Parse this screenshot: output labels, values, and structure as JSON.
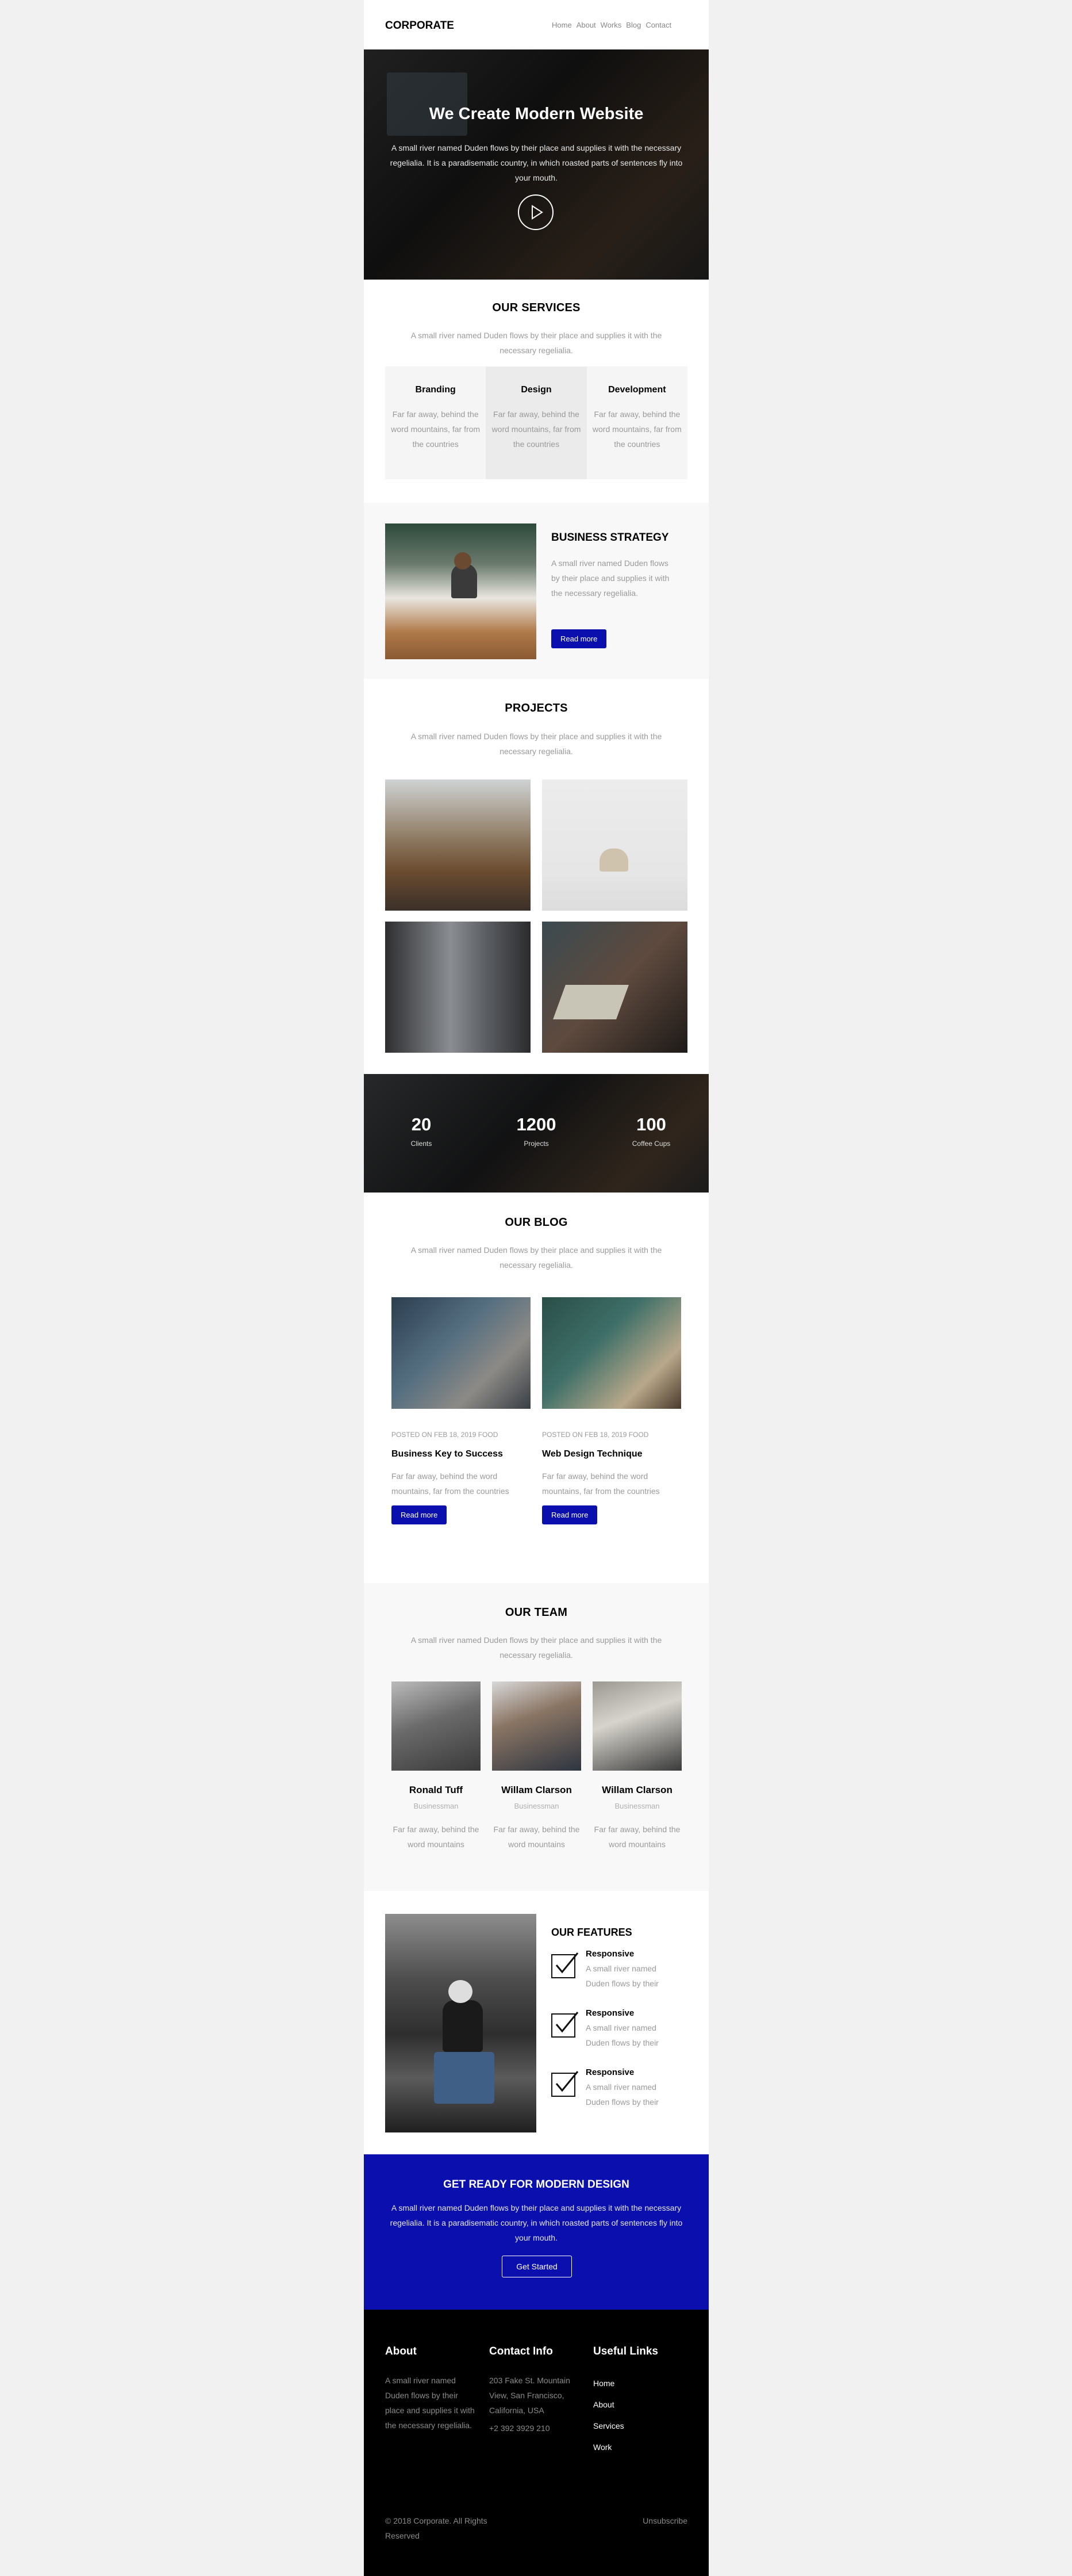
{
  "brand": "CORPORATE",
  "nav": [
    "Home",
    "About",
    "Works",
    "Blog",
    "Contact"
  ],
  "hero": {
    "title": "We Create Modern Website",
    "text": "A small river named Duden flows by their place and supplies it with the necessary regelialia. It is a paradisematic country, in which roasted parts of sentences fly into your mouth."
  },
  "services": {
    "title": "OUR SERVICES",
    "subtitle": "A small river named Duden flows by their place and supplies it with the necessary regelialia.",
    "items": [
      {
        "title": "Branding",
        "text": "Far far away, behind the word mountains, far from the countries"
      },
      {
        "title": "Design",
        "text": "Far far away, behind the word mountains, far from the countries"
      },
      {
        "title": "Development",
        "text": "Far far away, behind the word mountains, far from the countries"
      }
    ]
  },
  "strategy": {
    "title": "BUSINESS STRATEGY",
    "text": "A small river named Duden flows by their place and supplies it with the necessary regelialia.",
    "button": "Read more"
  },
  "projects": {
    "title": "PROJECTS",
    "subtitle": "A small river named Duden flows by their place and supplies it with the necessary regelialia."
  },
  "counters": [
    {
      "value": "20",
      "label": "Clients"
    },
    {
      "value": "1200",
      "label": "Projects"
    },
    {
      "value": "100",
      "label": "Coffee Cups"
    }
  ],
  "blog": {
    "title": "OUR BLOG",
    "subtitle": "A small river named Duden flows by their place and supplies it with the necessary regelialia.",
    "posts": [
      {
        "meta": "POSTED ON FEB 18, 2019 FOOD",
        "title": "Business Key to Success",
        "text": "Far far away, behind the word mountains, far from the countries",
        "button": "Read more"
      },
      {
        "meta": "POSTED ON FEB 18, 2019 FOOD",
        "title": "Web Design Technique",
        "text": "Far far away, behind the word mountains, far from the countries",
        "button": "Read more"
      }
    ]
  },
  "team": {
    "title": "OUR TEAM",
    "subtitle": "A small river named Duden flows by their place and supplies it with the necessary regelialia.",
    "members": [
      {
        "name": "Ronald Tuff",
        "role": "Businessman",
        "text": "Far far away, behind the word mountains"
      },
      {
        "name": "Willam Clarson",
        "role": "Businessman",
        "text": "Far far away, behind the word mountains"
      },
      {
        "name": "Willam Clarson",
        "role": "Businessman",
        "text": "Far far away, behind the word mountains"
      }
    ]
  },
  "features": {
    "title": "OUR FEATURES",
    "items": [
      {
        "title": "Responsive",
        "text": "A small river named Duden flows by their"
      },
      {
        "title": "Responsive",
        "text": "A small river named Duden flows by their"
      },
      {
        "title": "Responsive",
        "text": "A small river named Duden flows by their"
      }
    ]
  },
  "cta": {
    "title": "GET READY FOR MODERN DESIGN",
    "text": "A small river named Duden flows by their place and supplies it with the necessary regelialia. It is a paradisematic country, in which roasted parts of sentences fly into your mouth.",
    "button": "Get Started"
  },
  "footer": {
    "about_title": "About",
    "about_text": "A small river named Duden flows by their place and supplies it with the necessary regelialia.",
    "contact_title": "Contact Info",
    "address": "203 Fake St. Mountain View, San Francisco, California, USA",
    "phone": "+2 392 3929 210",
    "links_title": "Useful Links",
    "links": [
      "Home",
      "About",
      "Services",
      "Work"
    ],
    "copyright": "© 2018 Corporate. All Rights Reserved",
    "unsubscribe": "Unsubscribe"
  },
  "colors": {
    "accent": "#0b0fad",
    "footer_bg": "#000000",
    "section_alt": "#f8f8f8"
  }
}
